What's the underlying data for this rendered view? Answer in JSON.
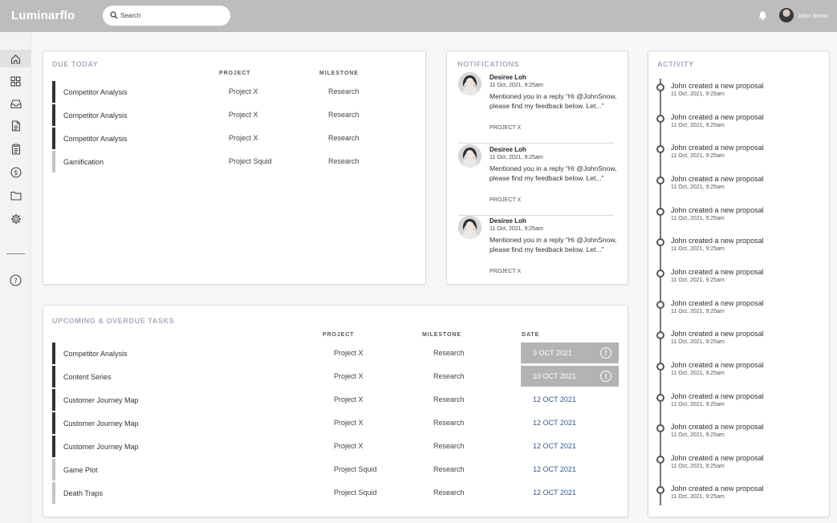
{
  "app": {
    "brand": "Luminarflo"
  },
  "header": {
    "search_placeholder": "Search",
    "user_name": "John Snow",
    "icons": {
      "search": "search-icon",
      "bell": "bell-icon",
      "avatar": "avatar"
    }
  },
  "sidebar": {
    "items": [
      {
        "icon": "home-icon",
        "active": true
      },
      {
        "icon": "dashboard-grid-icon",
        "active": false
      },
      {
        "icon": "inbox-icon",
        "active": false
      },
      {
        "icon": "document-icon",
        "active": false
      },
      {
        "icon": "clipboard-icon",
        "active": false
      },
      {
        "icon": "dollar-icon",
        "active": false
      },
      {
        "icon": "folder-icon",
        "active": false
      },
      {
        "icon": "settings-gear-icon",
        "active": false
      }
    ],
    "help_icon": "help-icon"
  },
  "due_today": {
    "title": "DUE TODAY",
    "columns": {
      "project": "PROJECT",
      "milestone": "MILESTONE"
    },
    "rows": [
      {
        "name": "Competitor Analysis",
        "project": "Project X",
        "milestone": "Research",
        "accent": "#333333"
      },
      {
        "name": "Competitor Analysis",
        "project": "Project X",
        "milestone": "Research",
        "accent": "#333333"
      },
      {
        "name": "Competitor Analysis",
        "project": "Project X",
        "milestone": "Research",
        "accent": "#333333"
      },
      {
        "name": "Gamification",
        "project": "Project Squid",
        "milestone": "Research",
        "accent": "#c4c4c4"
      }
    ]
  },
  "notifications": {
    "title": "NOTIFICATIONS",
    "items": [
      {
        "from": "Desiree Loh",
        "time": "11 Oct, 2021, 9:25am",
        "message": "Mentioned you in a reply “Hi @JohnSnow, please find my feedback below. Let...”",
        "project": "PROJECT X"
      },
      {
        "from": "Desiree Loh",
        "time": "11 Oct, 2021, 9:25am",
        "message": "Mentioned you in a reply “Hi @JohnSnow, please find my feedback below. Let...”",
        "project": "PROJECT X"
      },
      {
        "from": "Desiree Loh",
        "time": "11 Oct, 2021, 9:25am",
        "message": "Mentioned you in a reply “Hi @JohnSnow, please find my feedback below. Let...”",
        "project": "PROJECT X"
      }
    ]
  },
  "upcoming": {
    "title": "UPCOMING & OVERDUE TASKS",
    "columns": {
      "project": "PROJECT",
      "milestone": "MILESTONE",
      "date": "DATE"
    },
    "rows": [
      {
        "name": "Competitor Analysis",
        "project": "Project X",
        "milestone": "Research",
        "date": "9 OCT 2021",
        "overdue": true,
        "accent": "#333333"
      },
      {
        "name": "Content Series",
        "project": "Project X",
        "milestone": "Research",
        "date": "10 OCT 2021",
        "overdue": true,
        "accent": "#333333"
      },
      {
        "name": "Customer Journey Map",
        "project": "Project X",
        "milestone": "Research",
        "date": "12 OCT 2021",
        "overdue": false,
        "accent": "#333333"
      },
      {
        "name": "Customer Journey Map",
        "project": "Project X",
        "milestone": "Research",
        "date": "12 OCT 2021",
        "overdue": false,
        "accent": "#333333"
      },
      {
        "name": "Customer Journey Map",
        "project": "Project X",
        "milestone": "Research",
        "date": "12 OCT 2021",
        "overdue": false,
        "accent": "#333333"
      },
      {
        "name": "Game Plot",
        "project": "Project Squid",
        "milestone": "Research",
        "date": "12 OCT 2021",
        "overdue": false,
        "accent": "#c4c4c4"
      },
      {
        "name": "Death Traps",
        "project": "Project Squid",
        "milestone": "Research",
        "date": "12 OCT 2021",
        "overdue": false,
        "accent": "#c4c4c4"
      }
    ],
    "warning_icon": "warning-icon"
  },
  "activity": {
    "title": "ACTIVITY",
    "items": [
      {
        "text": "John created a new proposal",
        "time": "11 Oct, 2021, 9:25am"
      },
      {
        "text": "John created a new proposal",
        "time": "11 Oct, 2021, 9:25am"
      },
      {
        "text": "John created a new proposal",
        "time": "11 Oct, 2021, 9:25am"
      },
      {
        "text": "John created a new proposal",
        "time": "11 Oct, 2021, 9:25am"
      },
      {
        "text": "John created a new proposal",
        "time": "11 Oct, 2021, 9:25am"
      },
      {
        "text": "John created a new proposal",
        "time": "11 Oct, 2021, 9:25am"
      },
      {
        "text": "John created a new proposal",
        "time": "11 Oct, 2021, 9:25am"
      },
      {
        "text": "John created a new proposal",
        "time": "11 Oct, 2021, 9:25am"
      },
      {
        "text": "John created a new proposal",
        "time": "11 Oct, 2021, 9:25am"
      },
      {
        "text": "John created a new proposal",
        "time": "11 Oct, 2021, 9:25am"
      },
      {
        "text": "John created a new proposal",
        "time": "11 Oct, 2021, 9:25am"
      },
      {
        "text": "John created a new proposal",
        "time": "11 Oct, 2021, 9:25am"
      },
      {
        "text": "John created a new proposal",
        "time": "11 Oct, 2021, 9:25am"
      },
      {
        "text": "John created a new proposal",
        "time": "11 Oct, 2021, 9:25am"
      }
    ]
  },
  "colors": {
    "topbar": "#bdbdbd",
    "overdue_bg": "#b3b3b3",
    "date_blue": "#36598f",
    "title_gray": "#a6adc0"
  }
}
